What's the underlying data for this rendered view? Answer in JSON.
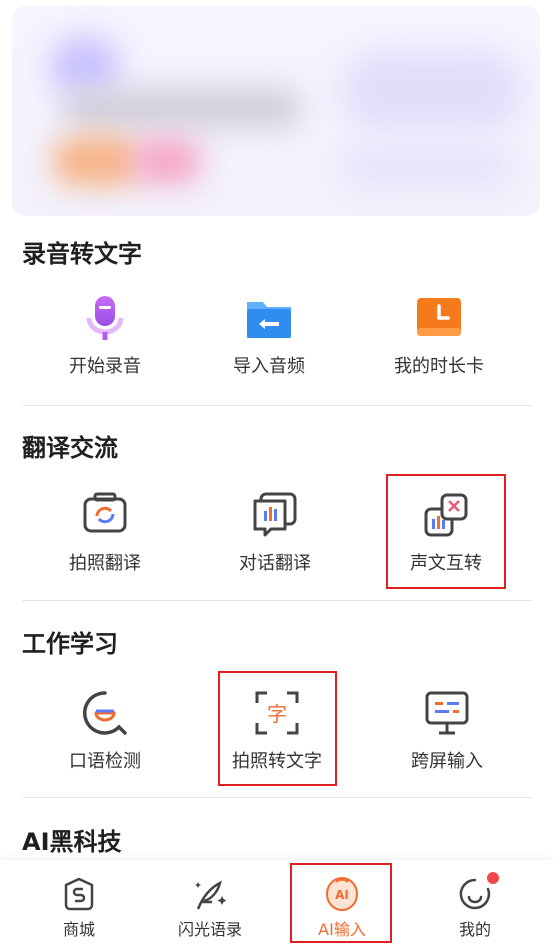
{
  "sections": {
    "recording": {
      "title": "录音转文字",
      "items": [
        {
          "label": "开始录音",
          "icon": "microphone-icon"
        },
        {
          "label": "导入音频",
          "icon": "folder-import-icon"
        },
        {
          "label": "我的时长卡",
          "icon": "time-card-icon"
        }
      ]
    },
    "translation": {
      "title": "翻译交流",
      "items": [
        {
          "label": "拍照翻译",
          "icon": "camera-translate-icon"
        },
        {
          "label": "对话翻译",
          "icon": "dialog-translate-icon"
        },
        {
          "label": "声文互转",
          "icon": "voice-text-convert-icon"
        }
      ]
    },
    "work": {
      "title": "工作学习",
      "items": [
        {
          "label": "口语检测",
          "icon": "speech-check-icon"
        },
        {
          "label": "拍照转文字",
          "icon": "photo-to-text-icon"
        },
        {
          "label": "跨屏输入",
          "icon": "cross-screen-icon"
        }
      ]
    },
    "ai": {
      "title": "AI黑科技"
    }
  },
  "nav": {
    "items": [
      {
        "label": "商城",
        "icon": "store-icon"
      },
      {
        "label": "闪光语录",
        "icon": "quill-sparkle-icon"
      },
      {
        "label": "AI输入",
        "icon": "ai-input-icon",
        "active": true
      },
      {
        "label": "我的",
        "icon": "profile-icon",
        "badge": true
      }
    ]
  },
  "colors": {
    "accent": "#f26b2f",
    "highlight": "#e02020",
    "mic": "#b45cf0",
    "folder": "#2f8cf0",
    "card": "#f57a1c"
  }
}
